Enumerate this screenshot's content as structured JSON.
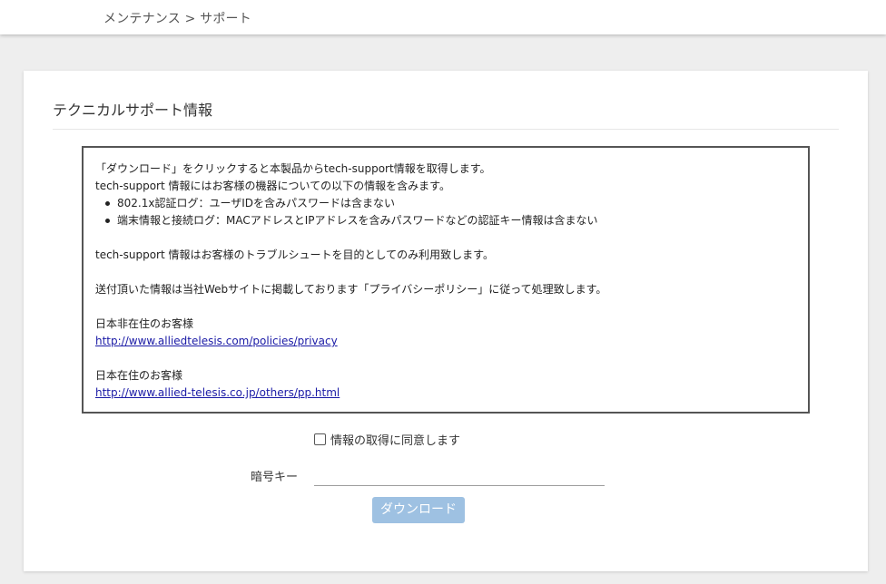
{
  "breadcrumb": "メンテナンス > サポート",
  "card": {
    "title": "テクニカルサポート情報"
  },
  "info": {
    "line1": "「ダウンロード」をクリックすると本製品からtech-support情報を取得します。",
    "line2": "tech-support 情報にはお客様の機器についての以下の情報を含みます。",
    "bullets": [
      "802.1x認証ログ：ユーザIDを含みパスワードは含まない",
      "端末情報と接続ログ：MACアドレスとIPアドレスを含みパスワードなどの認証キー情報は含まない"
    ],
    "purpose": "tech-support 情報はお客様のトラブルシュートを目的としてのみ利用致します。",
    "privacy": "送付頂いた情報は当社Webサイトに掲載しております「プライバシーポリシー」に従って処理致します。",
    "non_japan_label": "日本非在住のお客様",
    "non_japan_link": "http://www.alliedtelesis.com/policies/privacy",
    "japan_label": "日本在住のお客様",
    "japan_link": "http://www.allied-telesis.co.jp/others/pp.html"
  },
  "form": {
    "consent_label": "情報の取得に同意します",
    "key_label": "暗号キー",
    "key_value": "",
    "download_label": "ダウンロード"
  },
  "colors": {
    "button_bg": "#9ec1e2",
    "link": "#1a1aa6"
  }
}
